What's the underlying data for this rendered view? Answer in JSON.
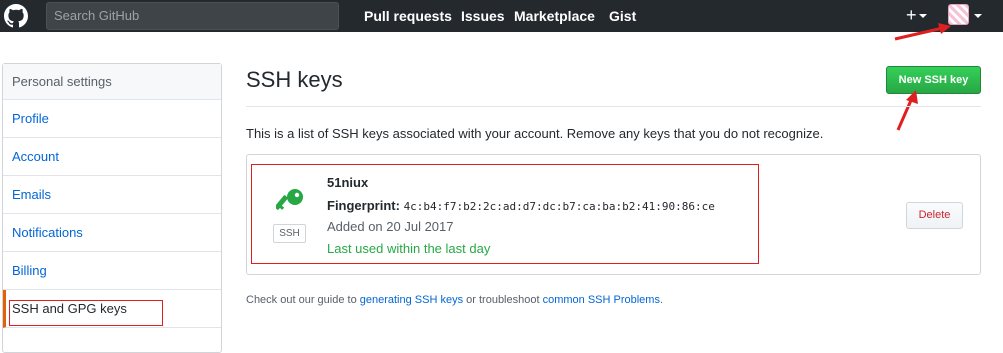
{
  "header": {
    "search_placeholder": "Search GitHub",
    "nav": [
      "Pull requests",
      "Issues",
      "Marketplace",
      "Gist"
    ],
    "plus": "+"
  },
  "sidebar": {
    "header": "Personal settings",
    "items": [
      {
        "label": "Profile"
      },
      {
        "label": "Account"
      },
      {
        "label": "Emails"
      },
      {
        "label": "Notifications"
      },
      {
        "label": "Billing"
      },
      {
        "label": "SSH and GPG keys"
      }
    ],
    "selected": "SSH and GPG keys"
  },
  "main": {
    "title": "SSH keys",
    "new_button": "New SSH key",
    "description": "This is a list of SSH keys associated with your account. Remove any keys that you do not recognize.",
    "key": {
      "badge": "SSH",
      "title": "51niux",
      "fingerprint_label": "Fingerprint:",
      "fingerprint": "4c:b4:f7:b2:2c:ad:d7:dc:b7:ca:ba:b2:41:90:86:ce",
      "added": "Added on 20 Jul 2017",
      "last_used": "Last used within the last day",
      "delete_button": "Delete"
    },
    "footer": {
      "prefix": "Check out our guide to ",
      "link1": "generating SSH keys",
      "middle": " or troubleshoot ",
      "link2": "common SSH Problems",
      "suffix": "."
    }
  },
  "colors": {
    "topbar": "#24292e",
    "link": "#0366d6",
    "accent_green": "#28a745",
    "annotation_red": "#e02020"
  }
}
